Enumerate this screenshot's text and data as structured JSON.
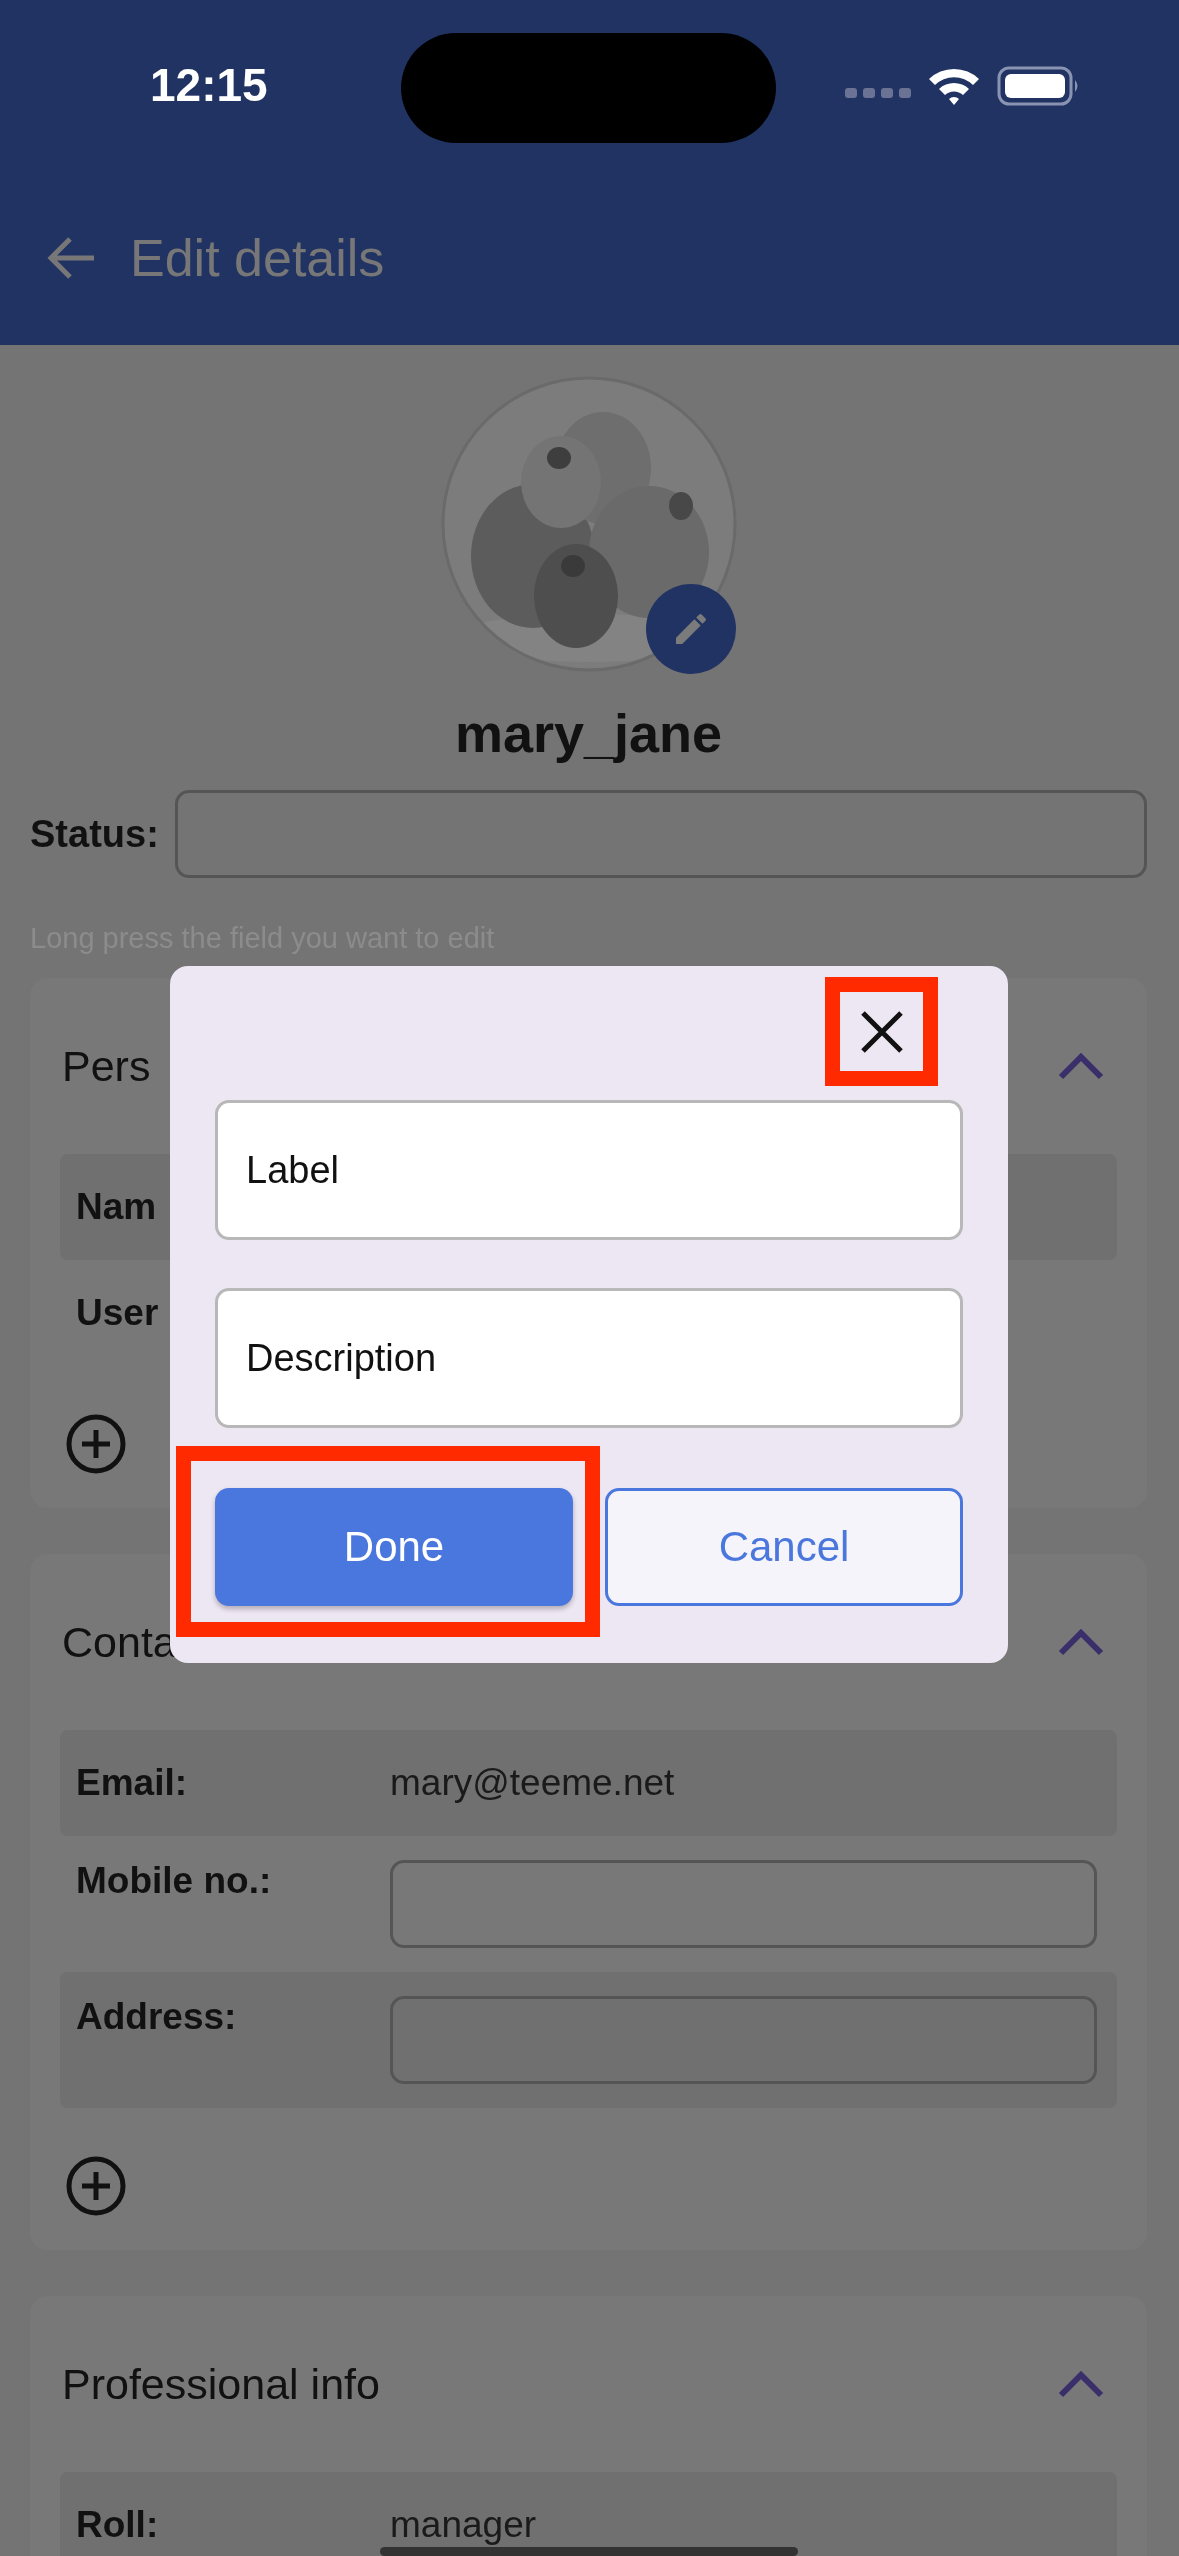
{
  "status_bar": {
    "time": "12:15"
  },
  "app_bar": {
    "title": "Edit details"
  },
  "profile": {
    "username": "mary_jane",
    "status_label": "Status:"
  },
  "hint": "Long press the field you want to edit",
  "sections": [
    {
      "title": "Pers",
      "expanded": true,
      "can_add": true,
      "rows": [
        {
          "label": "Nam",
          "kind": "text"
        },
        {
          "label": "User",
          "kind": "text"
        }
      ]
    },
    {
      "title": "Conta",
      "expanded": true,
      "can_add": true,
      "rows": [
        {
          "label": "Email:",
          "kind": "text",
          "value": "mary@teeme.net"
        },
        {
          "label": "Mobile no.:",
          "kind": "input"
        },
        {
          "label": "Address:",
          "kind": "input"
        }
      ]
    },
    {
      "title": "Professional info",
      "expanded": true,
      "rows": [
        {
          "label": "Roll:",
          "kind": "text",
          "value": "manager"
        }
      ]
    }
  ],
  "dialog": {
    "close_highlighted": true,
    "fields": [
      {
        "placeholder": "Label"
      },
      {
        "placeholder": "Description"
      }
    ],
    "buttons": [
      {
        "label": "Done",
        "kind": "primary",
        "highlighted": true
      },
      {
        "label": "Cancel",
        "kind": "secondary",
        "highlighted": false
      }
    ]
  }
}
